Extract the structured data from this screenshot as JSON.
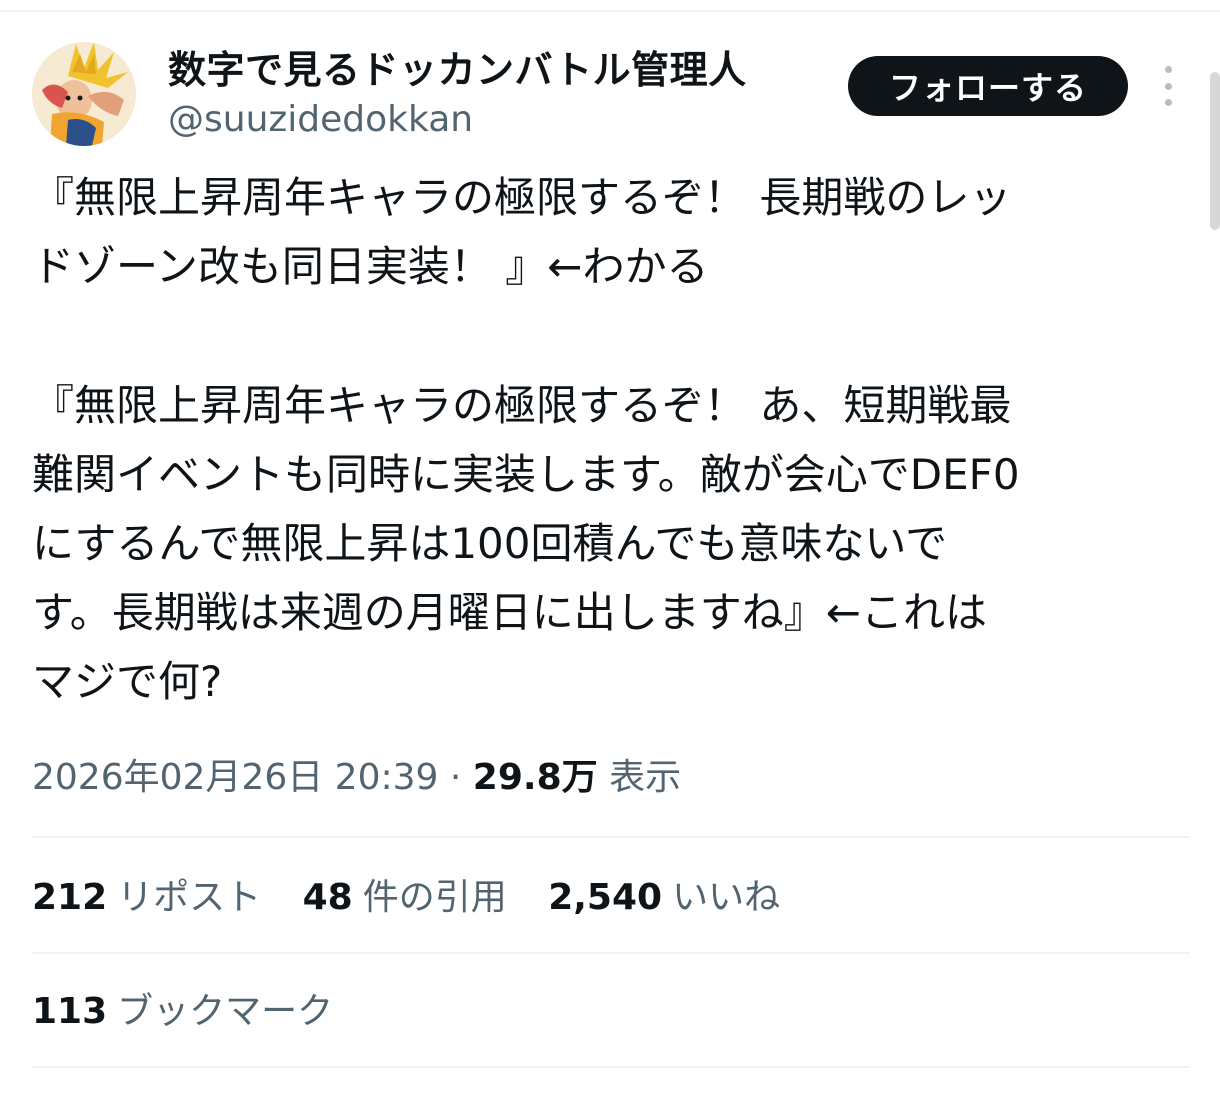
{
  "user": {
    "display_name": "数字で見るドッカンバトル管理人",
    "handle": "@suuzidedokkan"
  },
  "actions": {
    "follow_label": "フォローする",
    "more_icon": "more-vertical-icon"
  },
  "tweet": {
    "lines": [
      "『無限上昇周年キャラの極限するぞ！ 長期戦のレッ",
      "ドゾーン改も同日実装！ 』←わかる",
      "『無限上昇周年キャラの極限するぞ！ あ、短期戦最",
      "難関イベントも同時に実装します。敵が会心でDEF0",
      "にするんで無限上昇は100回積んでも意味ないで",
      "す。長期戦は来週の月曜日に出しますね』←これは",
      "マジで何?"
    ]
  },
  "meta": {
    "timestamp": "2026年02月26日 20:39",
    "separator": "·",
    "views_count": "29.8万",
    "views_label": "表示"
  },
  "stats": {
    "reposts_count": "212",
    "reposts_label": "リポスト",
    "quotes_count": "48",
    "quotes_label": "件の引用",
    "likes_count": "2,540",
    "likes_label": "いいね",
    "bookmarks_count": "113",
    "bookmarks_label": "ブックマーク"
  },
  "colors": {
    "text_primary": "#0f1419",
    "text_secondary": "#536471",
    "follow_button_bg": "#0f1419",
    "divider": "#eff3f4"
  }
}
